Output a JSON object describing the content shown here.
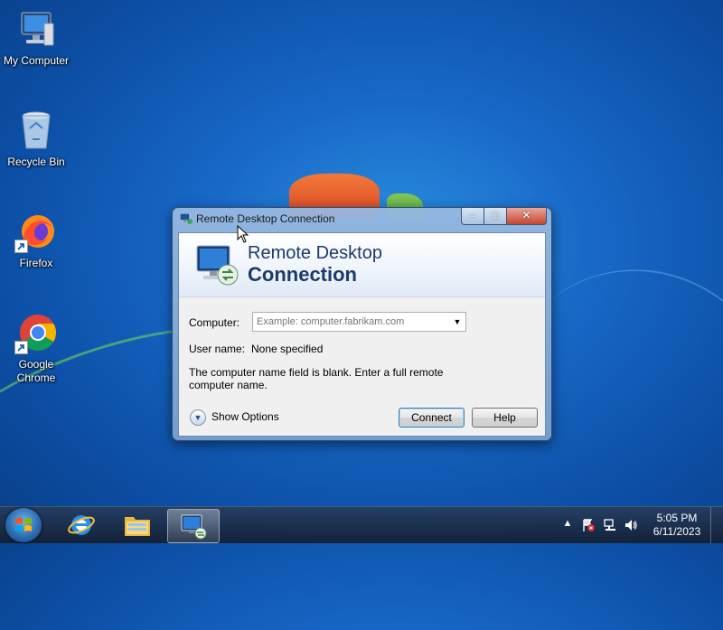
{
  "desktop": {
    "icons": [
      {
        "label": "My Computer",
        "icon": "computer-icon"
      },
      {
        "label": "Recycle Bin",
        "icon": "recycle-bin-icon"
      },
      {
        "label": "Firefox",
        "icon": "firefox-icon"
      },
      {
        "label": "Google Chrome",
        "icon": "chrome-icon"
      }
    ]
  },
  "window": {
    "title": "Remote Desktop Connection",
    "banner_line1": "Remote Desktop",
    "banner_line2": "Connection",
    "computer_label": "Computer:",
    "computer_value": "",
    "computer_placeholder": "Example: computer.fabrikam.com",
    "username_label": "User name:",
    "username_value": "None specified",
    "message": "The computer name field is blank. Enter a full remote computer name.",
    "show_options": "Show Options",
    "connect_button": "Connect",
    "help_button": "Help",
    "controls": {
      "minimize": "–",
      "maximize": "□",
      "close": "✕"
    }
  },
  "taskbar": {
    "pinned": [
      {
        "name": "Internet Explorer",
        "icon": "ie-icon"
      },
      {
        "name": "Windows Explorer",
        "icon": "folder-icon"
      },
      {
        "name": "Remote Desktop Connection",
        "icon": "rdp-icon",
        "active": true
      }
    ],
    "tray": {
      "icons": [
        "show-hidden-icons-arrow",
        "action-center-flag-icon",
        "network-icon",
        "volume-icon"
      ]
    },
    "clock": {
      "time": "5:05 PM",
      "date": "6/11/2023"
    }
  },
  "colors": {
    "desktop_blue": "#1868c6",
    "banner_text": "#1a3a6c",
    "close_red": "#c8452e"
  }
}
